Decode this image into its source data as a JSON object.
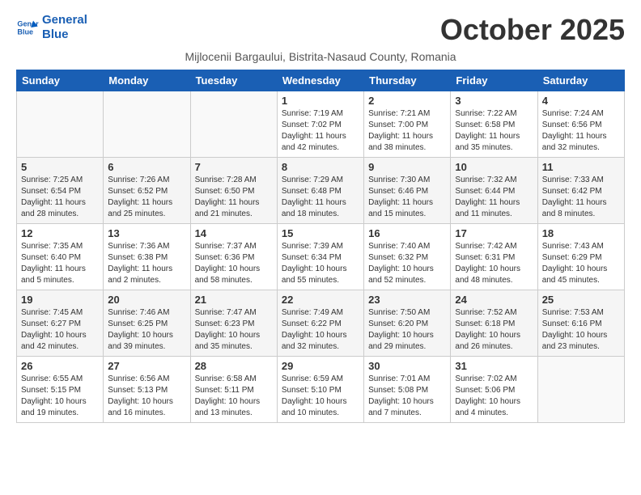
{
  "logo": {
    "line1": "General",
    "line2": "Blue"
  },
  "title": "October 2025",
  "subtitle": "Mijlocenii Bargaului, Bistrita-Nasaud County, Romania",
  "days_of_week": [
    "Sunday",
    "Monday",
    "Tuesday",
    "Wednesday",
    "Thursday",
    "Friday",
    "Saturday"
  ],
  "weeks": [
    [
      {
        "day": "",
        "info": ""
      },
      {
        "day": "",
        "info": ""
      },
      {
        "day": "",
        "info": ""
      },
      {
        "day": "1",
        "info": "Sunrise: 7:19 AM\nSunset: 7:02 PM\nDaylight: 11 hours and 42 minutes."
      },
      {
        "day": "2",
        "info": "Sunrise: 7:21 AM\nSunset: 7:00 PM\nDaylight: 11 hours and 38 minutes."
      },
      {
        "day": "3",
        "info": "Sunrise: 7:22 AM\nSunset: 6:58 PM\nDaylight: 11 hours and 35 minutes."
      },
      {
        "day": "4",
        "info": "Sunrise: 7:24 AM\nSunset: 6:56 PM\nDaylight: 11 hours and 32 minutes."
      }
    ],
    [
      {
        "day": "5",
        "info": "Sunrise: 7:25 AM\nSunset: 6:54 PM\nDaylight: 11 hours and 28 minutes."
      },
      {
        "day": "6",
        "info": "Sunrise: 7:26 AM\nSunset: 6:52 PM\nDaylight: 11 hours and 25 minutes."
      },
      {
        "day": "7",
        "info": "Sunrise: 7:28 AM\nSunset: 6:50 PM\nDaylight: 11 hours and 21 minutes."
      },
      {
        "day": "8",
        "info": "Sunrise: 7:29 AM\nSunset: 6:48 PM\nDaylight: 11 hours and 18 minutes."
      },
      {
        "day": "9",
        "info": "Sunrise: 7:30 AM\nSunset: 6:46 PM\nDaylight: 11 hours and 15 minutes."
      },
      {
        "day": "10",
        "info": "Sunrise: 7:32 AM\nSunset: 6:44 PM\nDaylight: 11 hours and 11 minutes."
      },
      {
        "day": "11",
        "info": "Sunrise: 7:33 AM\nSunset: 6:42 PM\nDaylight: 11 hours and 8 minutes."
      }
    ],
    [
      {
        "day": "12",
        "info": "Sunrise: 7:35 AM\nSunset: 6:40 PM\nDaylight: 11 hours and 5 minutes."
      },
      {
        "day": "13",
        "info": "Sunrise: 7:36 AM\nSunset: 6:38 PM\nDaylight: 11 hours and 2 minutes."
      },
      {
        "day": "14",
        "info": "Sunrise: 7:37 AM\nSunset: 6:36 PM\nDaylight: 10 hours and 58 minutes."
      },
      {
        "day": "15",
        "info": "Sunrise: 7:39 AM\nSunset: 6:34 PM\nDaylight: 10 hours and 55 minutes."
      },
      {
        "day": "16",
        "info": "Sunrise: 7:40 AM\nSunset: 6:32 PM\nDaylight: 10 hours and 52 minutes."
      },
      {
        "day": "17",
        "info": "Sunrise: 7:42 AM\nSunset: 6:31 PM\nDaylight: 10 hours and 48 minutes."
      },
      {
        "day": "18",
        "info": "Sunrise: 7:43 AM\nSunset: 6:29 PM\nDaylight: 10 hours and 45 minutes."
      }
    ],
    [
      {
        "day": "19",
        "info": "Sunrise: 7:45 AM\nSunset: 6:27 PM\nDaylight: 10 hours and 42 minutes."
      },
      {
        "day": "20",
        "info": "Sunrise: 7:46 AM\nSunset: 6:25 PM\nDaylight: 10 hours and 39 minutes."
      },
      {
        "day": "21",
        "info": "Sunrise: 7:47 AM\nSunset: 6:23 PM\nDaylight: 10 hours and 35 minutes."
      },
      {
        "day": "22",
        "info": "Sunrise: 7:49 AM\nSunset: 6:22 PM\nDaylight: 10 hours and 32 minutes."
      },
      {
        "day": "23",
        "info": "Sunrise: 7:50 AM\nSunset: 6:20 PM\nDaylight: 10 hours and 29 minutes."
      },
      {
        "day": "24",
        "info": "Sunrise: 7:52 AM\nSunset: 6:18 PM\nDaylight: 10 hours and 26 minutes."
      },
      {
        "day": "25",
        "info": "Sunrise: 7:53 AM\nSunset: 6:16 PM\nDaylight: 10 hours and 23 minutes."
      }
    ],
    [
      {
        "day": "26",
        "info": "Sunrise: 6:55 AM\nSunset: 5:15 PM\nDaylight: 10 hours and 19 minutes."
      },
      {
        "day": "27",
        "info": "Sunrise: 6:56 AM\nSunset: 5:13 PM\nDaylight: 10 hours and 16 minutes."
      },
      {
        "day": "28",
        "info": "Sunrise: 6:58 AM\nSunset: 5:11 PM\nDaylight: 10 hours and 13 minutes."
      },
      {
        "day": "29",
        "info": "Sunrise: 6:59 AM\nSunset: 5:10 PM\nDaylight: 10 hours and 10 minutes."
      },
      {
        "day": "30",
        "info": "Sunrise: 7:01 AM\nSunset: 5:08 PM\nDaylight: 10 hours and 7 minutes."
      },
      {
        "day": "31",
        "info": "Sunrise: 7:02 AM\nSunset: 5:06 PM\nDaylight: 10 hours and 4 minutes."
      },
      {
        "day": "",
        "info": ""
      }
    ]
  ]
}
